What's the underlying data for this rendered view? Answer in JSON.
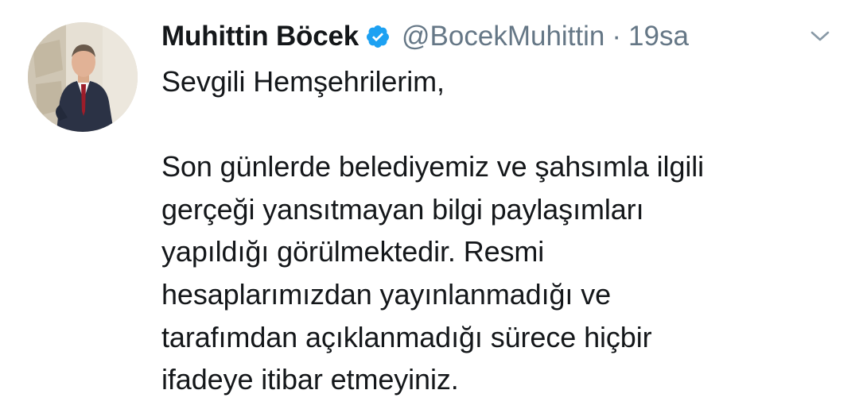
{
  "author": {
    "name": "Muhittin Böcek",
    "handle": "@BocekMuhittin",
    "separator": "·",
    "time": "19sa",
    "verified": true,
    "verified_color": "#1da1f2"
  },
  "tweet": {
    "greeting": "Sevgili Hemşehrilerim,",
    "lines": [
      "Son günlerde belediyemiz ve şahsımla ilgili",
      "gerçeği yansıtmayan bilgi paylaşımları",
      "yapıldığı görülmektedir. Resmi",
      "hesaplarımızdan yayınlanmadığı ve",
      "tarafımdan açıklanmadığı sürece hiçbir",
      "ifadeye itibar etmeyiniz."
    ]
  },
  "icons": {
    "verified": "verified-badge-icon",
    "menu": "chevron-down-icon"
  },
  "colors": {
    "text_primary": "#14171a",
    "text_secondary": "#657786",
    "chevron": "#8899a6"
  }
}
